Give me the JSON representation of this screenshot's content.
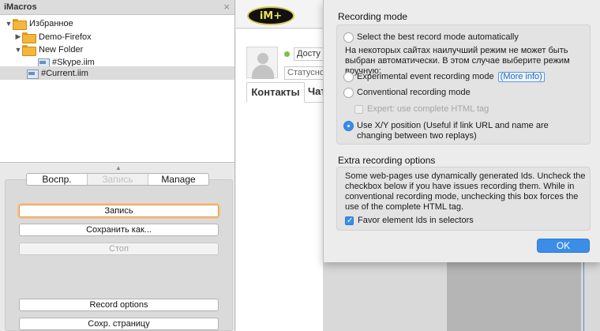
{
  "imacros": {
    "title": "iMacros",
    "close_icon": "×",
    "tree": [
      {
        "label": "Избранное",
        "type": "folder",
        "expanded": true
      },
      {
        "label": "Demo-Firefox",
        "type": "folder",
        "expanded": false
      },
      {
        "label": "New Folder",
        "type": "folder",
        "expanded": true
      },
      {
        "label": "#Skype.iim",
        "type": "file"
      },
      {
        "label": "#Current.iim",
        "type": "file",
        "selected": true
      }
    ],
    "tabs": [
      {
        "label": "Воспр.",
        "enabled": true
      },
      {
        "label": "Запись",
        "enabled": false
      },
      {
        "label": "Manage",
        "enabled": true
      }
    ],
    "buttons": {
      "record": "Запись",
      "save_as": "Сохранить как...",
      "stop": "Стоп",
      "record_options": "Record options",
      "save_page": "Сохр. страницу"
    }
  },
  "browser": {
    "logo_text": "iM+",
    "status_select": "Досту",
    "status_input": "Статусно",
    "tabs": {
      "contacts": "Контакты",
      "chats": "Чат"
    }
  },
  "dialog": {
    "mode_title": "Recording mode",
    "auto_option": "Select the best record mode automatically",
    "auto_note": "На некоторых сайтах наилучший режим не может быть выбран автоматически. В этом случае выберите режим вручную:",
    "experimental_option": "Experimental event recording mode",
    "more_info": "(More info)",
    "conventional_option": "Conventional recording mode",
    "expert_option": "Expert: use complete HTML tag",
    "xy_option": "Use X/Y position (Useful if link URL and name are changing between two replays)",
    "extra_title": "Extra recording options",
    "extra_note": "Some web-pages use dynamically generated Ids. Uncheck the checkbox below if you have issues recording them. While in conventional recording mode, unchecking this box forces the use of the complete HTML tag.",
    "favor_ids_option": "Favor element Ids in selectors",
    "ok_label": "OK",
    "selected_mode": "xy",
    "favor_ids_checked": true
  },
  "colors": {
    "accent": "#3b8de8",
    "focus_ring": "#f3c38d",
    "status_online": "#7cc04a"
  }
}
